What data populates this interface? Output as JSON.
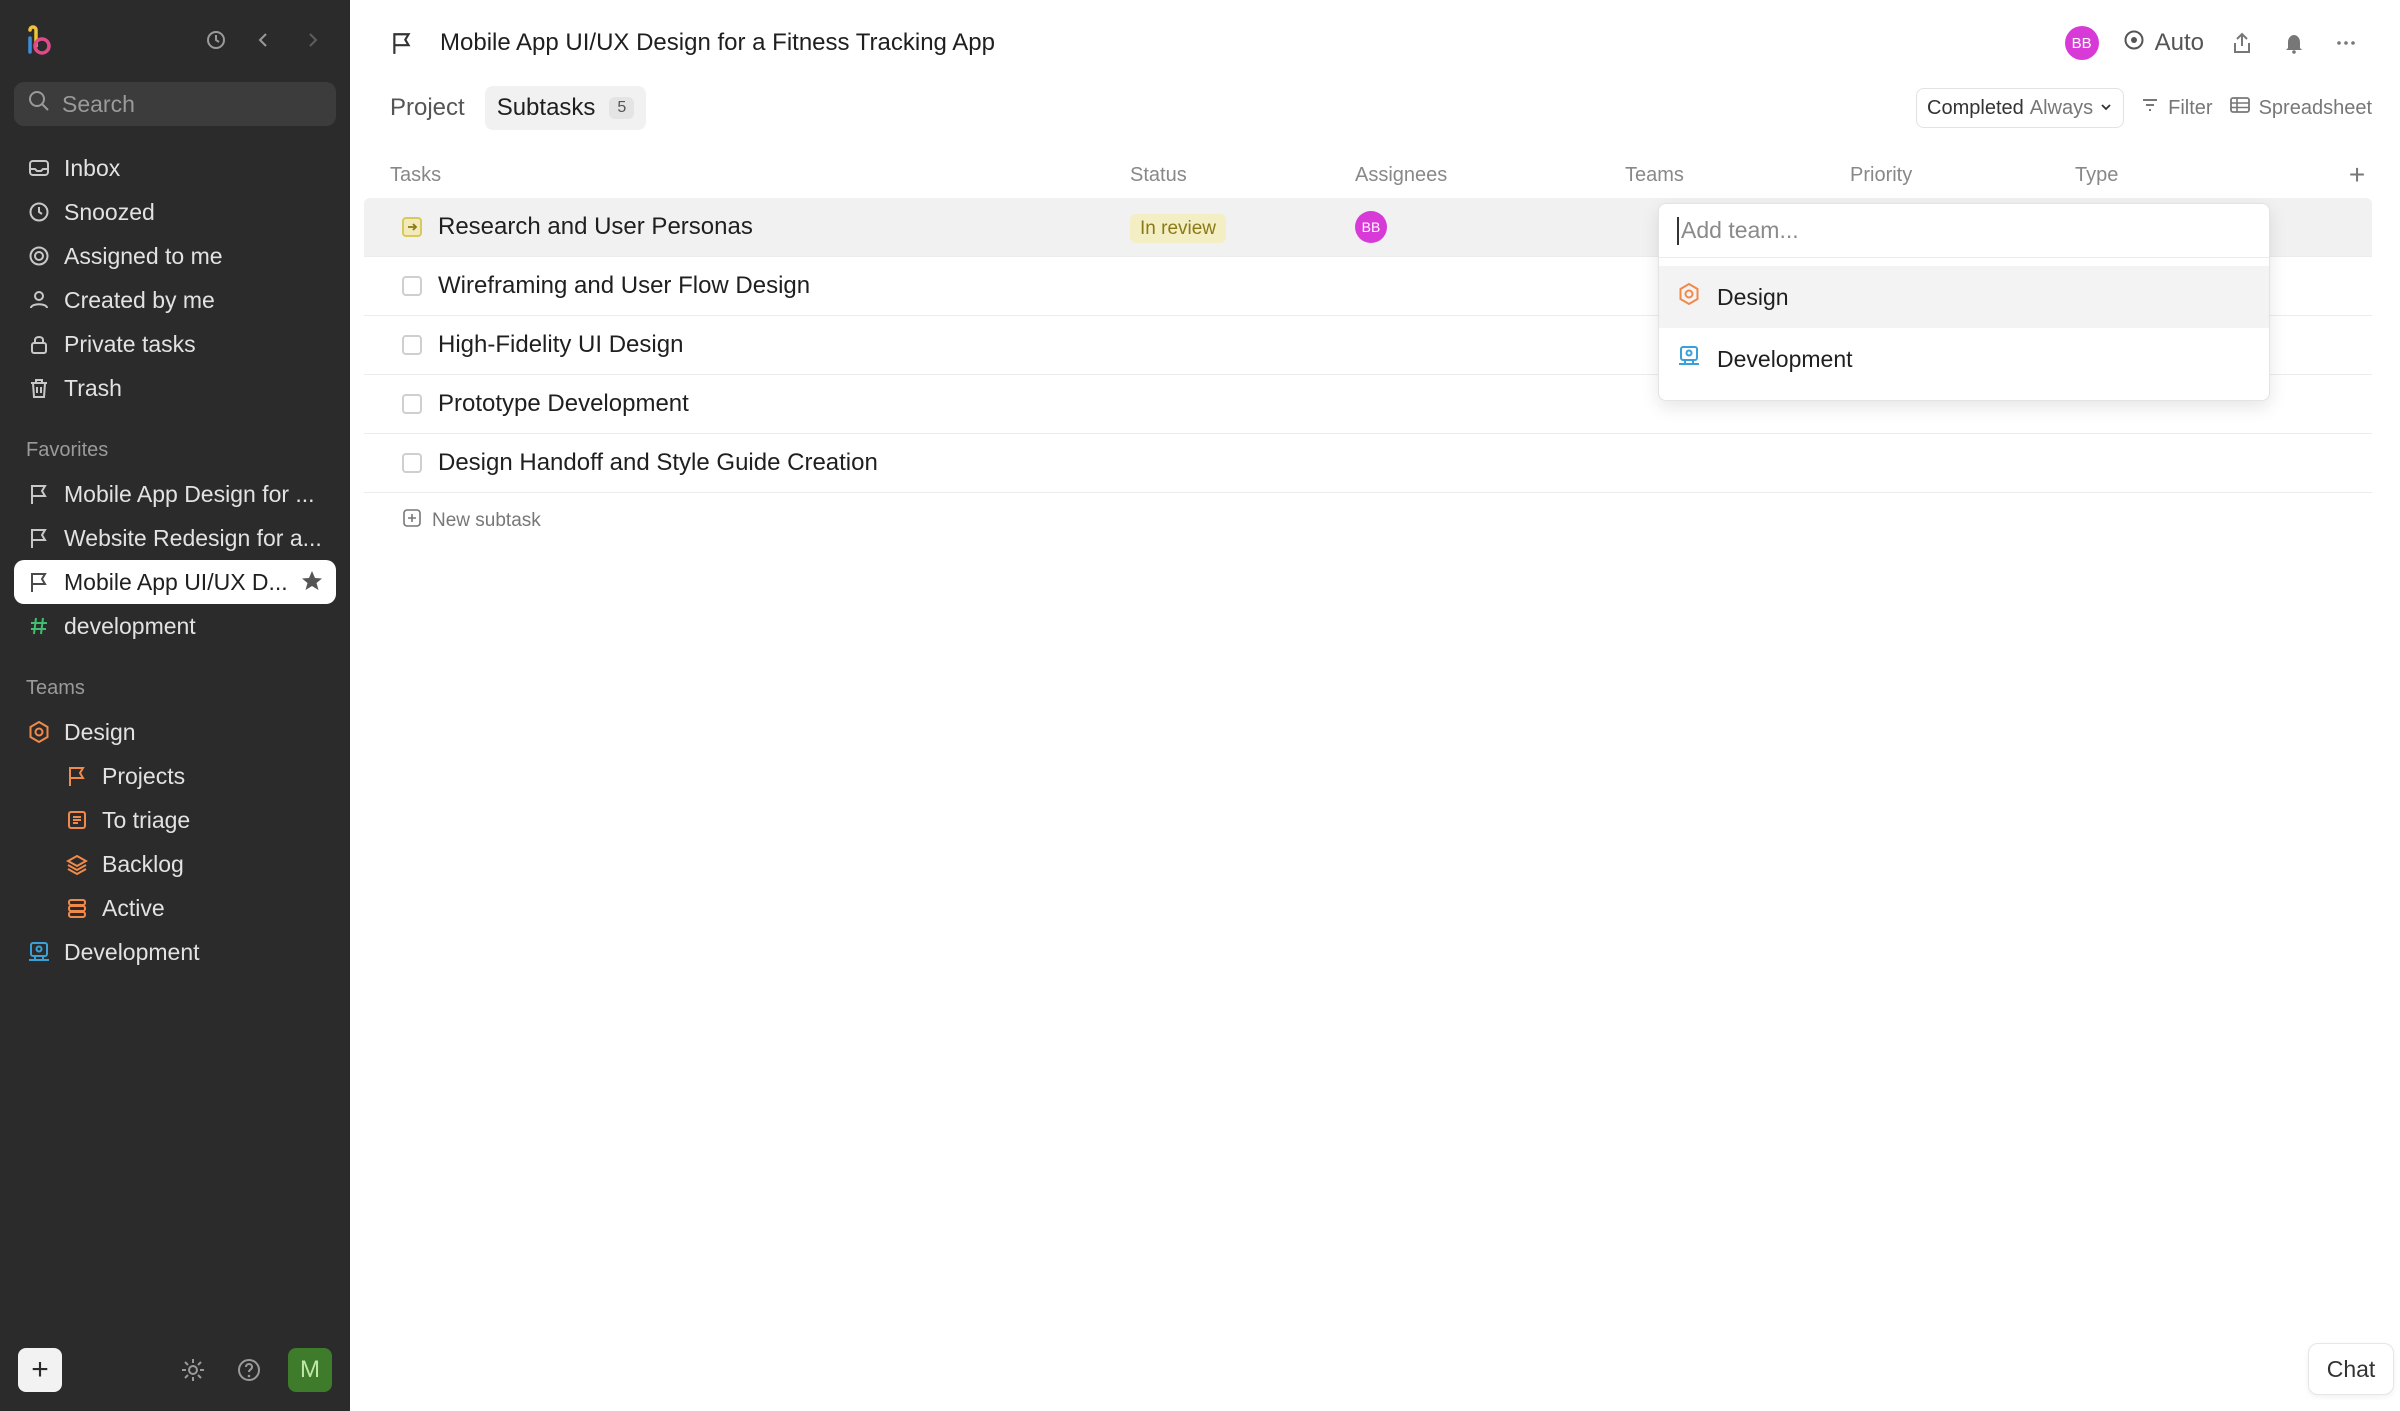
{
  "sidebar": {
    "search_placeholder": "Search",
    "nav": [
      {
        "label": "Inbox",
        "icon": "inbox-icon"
      },
      {
        "label": "Snoozed",
        "icon": "clock-icon"
      },
      {
        "label": "Assigned to me",
        "icon": "target-icon"
      },
      {
        "label": "Created by me",
        "icon": "user-icon"
      },
      {
        "label": "Private tasks",
        "icon": "lock-icon"
      },
      {
        "label": "Trash",
        "icon": "trash-icon"
      }
    ],
    "favorites_title": "Favorites",
    "favorites": [
      {
        "label": "Mobile App Design for ...",
        "icon": "flag-icon"
      },
      {
        "label": "Website Redesign for a...",
        "icon": "flag-icon"
      },
      {
        "label": "Mobile App UI/UX D...",
        "icon": "flag-icon",
        "active": true
      },
      {
        "label": "development",
        "icon": "hash-icon"
      }
    ],
    "teams_title": "Teams",
    "teams": [
      {
        "label": "Design",
        "icon": "design-team-icon"
      },
      {
        "label": "Projects",
        "icon": "flag-icon"
      },
      {
        "label": "To triage",
        "icon": "triage-icon"
      },
      {
        "label": "Backlog",
        "icon": "layers-icon"
      },
      {
        "label": "Active",
        "icon": "stack-icon"
      },
      {
        "label": "Development",
        "icon": "development-team-icon"
      }
    ],
    "user_initial": "M"
  },
  "header": {
    "title": "Mobile App UI/UX Design for a Fitness Tracking App",
    "avatar": "BB",
    "auto_label": "Auto"
  },
  "tabs": {
    "project": "Project",
    "subtasks": "Subtasks",
    "subtasks_count": "5",
    "completed": "Completed",
    "completed_value": "Always",
    "filter": "Filter",
    "view": "Spreadsheet"
  },
  "table": {
    "columns": {
      "tasks": "Tasks",
      "status": "Status",
      "assignees": "Assignees",
      "teams": "Teams",
      "priority": "Priority",
      "type": "Type"
    },
    "rows": [
      {
        "name": "Research and User Personas",
        "status": "In review",
        "assignee": "BB"
      },
      {
        "name": "Wireframing and User Flow Design"
      },
      {
        "name": "High-Fidelity UI Design"
      },
      {
        "name": "Prototype Development"
      },
      {
        "name": "Design Handoff and Style Guide Creation"
      }
    ],
    "new_subtask": "New subtask"
  },
  "team_dropdown": {
    "placeholder": "Add team...",
    "options": [
      {
        "label": "Design",
        "icon": "design-team-icon"
      },
      {
        "label": "Development",
        "icon": "development-team-icon"
      }
    ]
  },
  "chat_label": "Chat",
  "colors": {
    "sidebar_bg": "#2b2b2b",
    "design_accent": "#f08a4b",
    "development_accent": "#3aa0d8",
    "avatar_bb": "#d83ad8",
    "in_review_bg": "#f3eec4",
    "in_review_text": "#8a7a16",
    "hash_green": "#3fbf6f"
  }
}
